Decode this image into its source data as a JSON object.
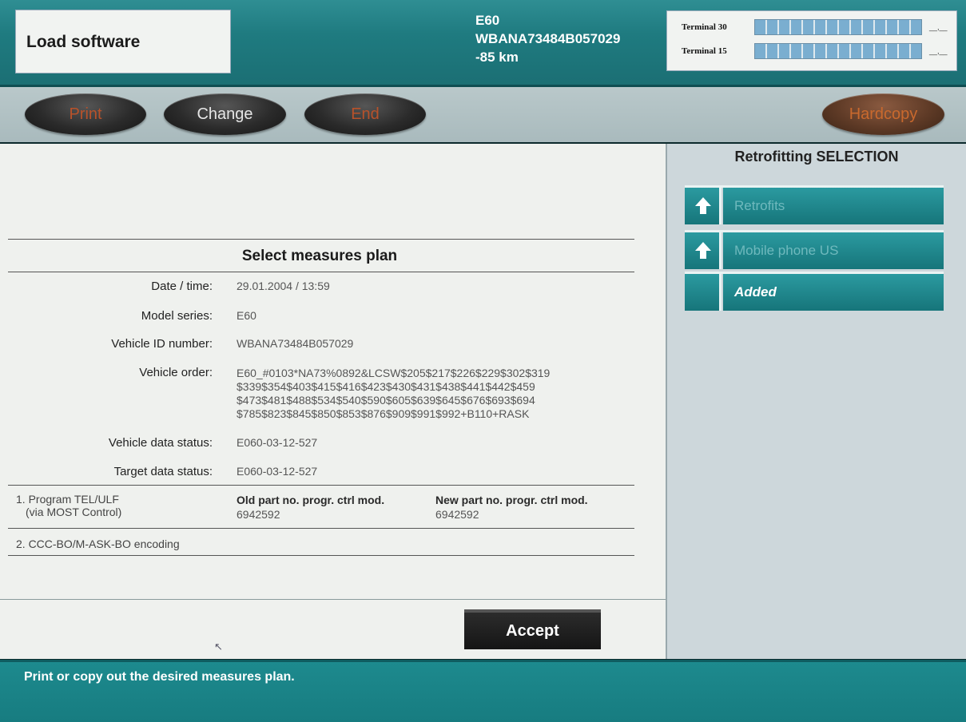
{
  "header": {
    "title": "Load software",
    "vehicle": {
      "model": "E60",
      "vin": "WBANA73484B057029",
      "distance": "-85 km"
    },
    "terminals": [
      {
        "label": "Terminal 30",
        "value": "__,__"
      },
      {
        "label": "Terminal 15",
        "value": "__,__"
      }
    ]
  },
  "toolbar": {
    "print_label": "Print",
    "change_label": "Change",
    "end_label": "End",
    "hardcopy_label": "Hardcopy"
  },
  "main": {
    "section_title": "Select measures plan",
    "fields": [
      {
        "label": "Date / time:",
        "value": "29.01.2004 / 13:59"
      },
      {
        "label": "Model series:",
        "value": "E60"
      },
      {
        "label": "Vehicle ID number:",
        "value": "WBANA73484B057029"
      },
      {
        "label": "Vehicle order:",
        "value": "E60_#0103*NA73%0892&LCSW$205$217$226$229$302$319\n$339$354$403$415$416$423$430$431$438$441$442$459\n$473$481$488$534$540$590$605$639$645$676$693$694\n$785$823$845$850$853$876$909$991$992+B110+RASK"
      },
      {
        "label": "Vehicle data status:",
        "value": "E060-03-12-527"
      },
      {
        "label": "Target data status:",
        "value": "E060-03-12-527"
      }
    ],
    "measures": [
      {
        "name": "1. Program TEL/ULF",
        "sub": "(via MOST Control)",
        "old_header": "Old part no. progr. ctrl mod.",
        "old_value": "6942592",
        "new_header": "New part no. progr. ctrl mod.",
        "new_value": "6942592"
      },
      {
        "name": "2. CCC-BO/M-ASK-BO encoding"
      }
    ],
    "accept_label": "Accept"
  },
  "sidebar": {
    "title": "Retrofitting SELECTION",
    "items": [
      {
        "label": "Retrofits",
        "icon": "up-arrow-icon",
        "state": "inactive"
      },
      {
        "label": "Mobile phone US",
        "icon": "up-arrow-icon",
        "state": "inactive"
      },
      {
        "label": "Added",
        "icon": "",
        "state": "active"
      }
    ]
  },
  "status": {
    "message": "Print or copy out the desired measures plan."
  }
}
